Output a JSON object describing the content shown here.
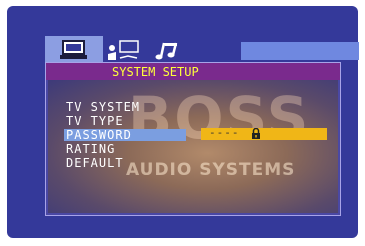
{
  "header": {
    "title": "SYSTEM SETUP"
  },
  "tabs": [
    {
      "icon": "monitor-icon",
      "active": true
    },
    {
      "icon": "speaker-icon",
      "active": false
    },
    {
      "icon": "music-note-icon",
      "active": false
    }
  ],
  "menu": {
    "items": [
      {
        "label": "TV SYSTEM"
      },
      {
        "label": "TV TYPE"
      },
      {
        "label": "PASSWORD",
        "selected": true
      },
      {
        "label": "RATING"
      },
      {
        "label": "DEFAULT"
      }
    ]
  },
  "password": {
    "value": "----",
    "icon": "lock-icon"
  },
  "background": {
    "watermark_top": "BOSS",
    "watermark_bottom": "AUDIO SYSTEMS"
  },
  "colors": {
    "screen": "#34399a",
    "title_bar": "#7a2a8d",
    "title_text": "#ffff3a",
    "highlight": "#7b9ee0",
    "value_box": "#f0b617"
  }
}
